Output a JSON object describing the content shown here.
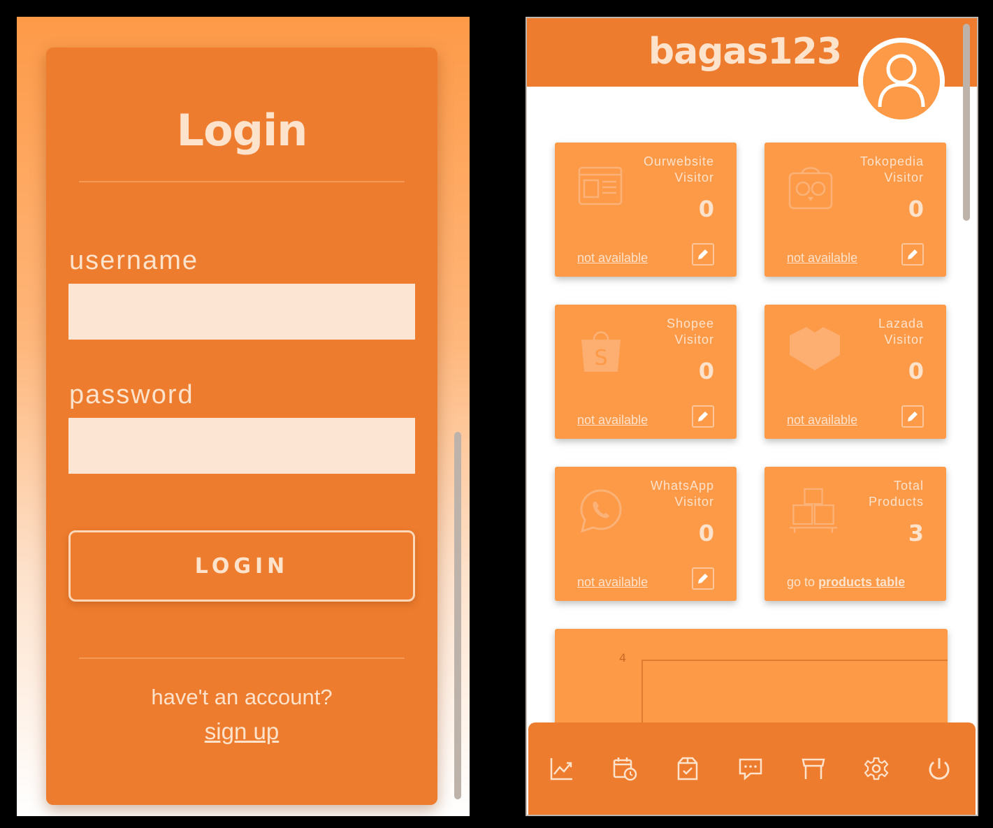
{
  "login": {
    "title": "Login",
    "username_label": "username",
    "password_label": "password",
    "username_value": "",
    "password_value": "",
    "login_button": "LOGIN",
    "signup_prompt": "have't an account?",
    "signup_link": "sign up"
  },
  "dashboard": {
    "username": "bagas123",
    "cards": [
      {
        "label_line1": "Ourwebsite",
        "label_line2": "Visitor",
        "value": "0",
        "link": "not available",
        "icon": "website-icon"
      },
      {
        "label_line1": "Tokopedia",
        "label_line2": "Visitor",
        "value": "0",
        "link": "not available",
        "icon": "tokopedia-icon"
      },
      {
        "label_line1": "Shopee",
        "label_line2": "Visitor",
        "value": "0",
        "link": "not available",
        "icon": "shopee-icon"
      },
      {
        "label_line1": "Lazada",
        "label_line2": "Visitor",
        "value": "0",
        "link": "not available",
        "icon": "lazada-icon"
      },
      {
        "label_line1": "WhatsApp",
        "label_line2": "Visitor",
        "value": "0",
        "link": "not available",
        "icon": "whatsapp-icon"
      },
      {
        "label_line1": "Total",
        "label_line2": "Products",
        "value": "3",
        "link_prefix": "go to",
        "link": "products table",
        "icon": "products-icon"
      }
    ],
    "chart": {
      "y_tick_top": "4"
    },
    "nav": [
      "chart-line-icon",
      "calendar-clock-icon",
      "box-check-icon",
      "chat-icon",
      "store-icon",
      "gear-icon",
      "power-icon"
    ]
  },
  "colors": {
    "primary": "#ee7c2e",
    "card": "#fd9a48",
    "text_light": "#fde2cc",
    "input_bg": "#fde5d4"
  }
}
